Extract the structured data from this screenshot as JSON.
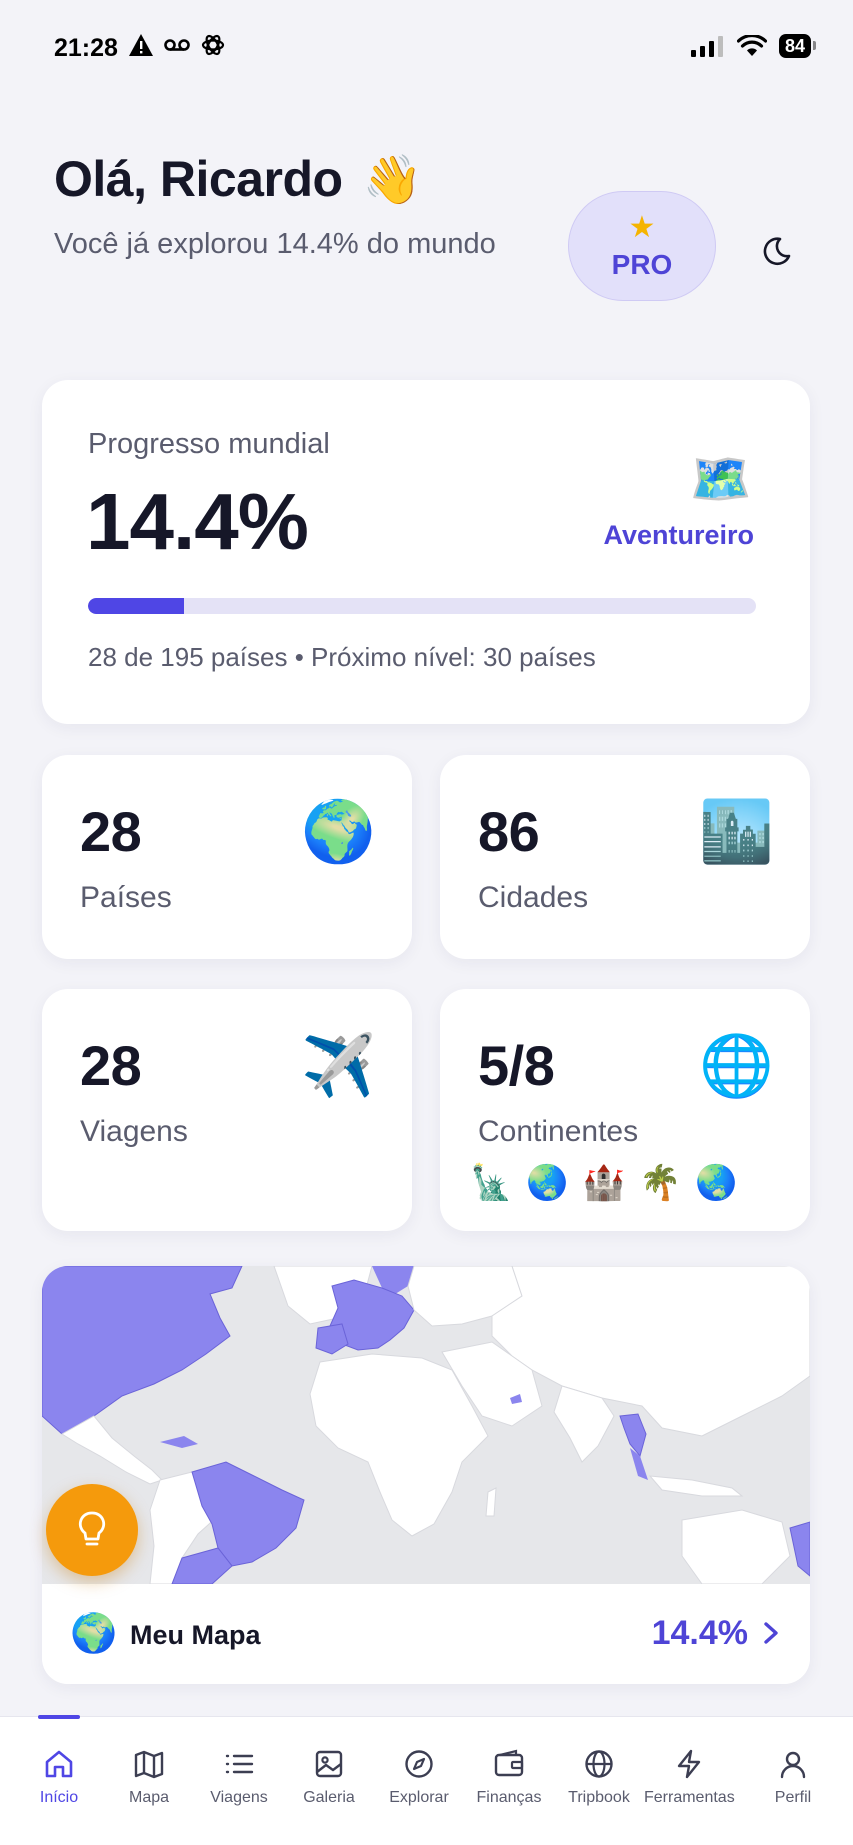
{
  "status_bar": {
    "time": "21:28",
    "battery": "84"
  },
  "header": {
    "greeting": "Olá, Ricardo",
    "greeting_emoji": "👋",
    "subtitle": "Você já explorou 14.4% do mundo",
    "pro_label": "PRO",
    "pro_icon": "star-icon",
    "theme_icon": "moon-icon"
  },
  "progress": {
    "title": "Progresso mundial",
    "percent_text": "14.4%",
    "percent_value": 14.4,
    "level": "Aventureiro",
    "emoji": "🗺️",
    "summary": "28 de 195 países • Próximo nível: 30 países"
  },
  "stats": {
    "countries": {
      "value": "28",
      "label": "Países",
      "emoji": "🌍"
    },
    "cities": {
      "value": "86",
      "label": "Cidades",
      "emoji": "🏙️"
    },
    "trips": {
      "value": "28",
      "label": "Viagens",
      "emoji": "✈️"
    },
    "continents": {
      "value": "5/8",
      "label": "Continentes",
      "emoji": "🌐",
      "badges": [
        "🗽",
        "🌏",
        "🏰",
        "🌴",
        "🌏"
      ]
    }
  },
  "map": {
    "title": "Meu Mapa",
    "emoji": "🌍",
    "percent_text": "14.4%",
    "visited_color": "#8b85ee",
    "land_color": "#ffffff",
    "water_color": "#e6e7ea"
  },
  "tips_button": {
    "icon": "lightbulb-icon",
    "color": "#f59a0c"
  },
  "nav": {
    "items": [
      {
        "label": "Início",
        "icon": "home-icon"
      },
      {
        "label": "Mapa",
        "icon": "map-icon"
      },
      {
        "label": "Viagens",
        "icon": "list-icon"
      },
      {
        "label": "Galeria",
        "icon": "image-icon"
      },
      {
        "label": "Explorar",
        "icon": "compass-icon"
      },
      {
        "label": "Finanças",
        "icon": "wallet-icon"
      },
      {
        "label": "Tripbook",
        "icon": "globe-icon"
      },
      {
        "label": "Ferramentas",
        "icon": "bolt-icon"
      },
      {
        "label": "Perfil",
        "icon": "user-icon"
      }
    ],
    "active_color": "#4f46e5"
  }
}
